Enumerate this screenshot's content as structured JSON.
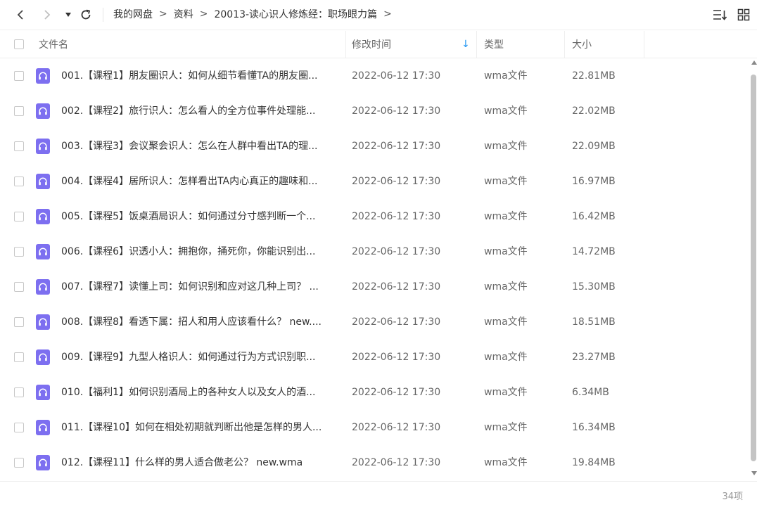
{
  "nav": {
    "back_icon": "chevron-left-icon",
    "forward_icon": "chevron-right-icon",
    "history_icon": "caret-down-icon",
    "refresh_icon": "refresh-icon"
  },
  "breadcrumb": [
    "我的网盘",
    "资料",
    "20013-读心识人修炼经：职场眼力篇"
  ],
  "breadcrumb_separator": ">",
  "toolbar": {
    "sort_icon": "sort-list-icon",
    "grid_icon": "grid-view-icon"
  },
  "columns": {
    "name": "文件名",
    "modified": "修改时间",
    "type": "类型",
    "size": "大小",
    "sort_indicator": "↓"
  },
  "colors": {
    "accent": "#2196f3",
    "file_icon": "#7d6ff0"
  },
  "files": [
    {
      "name": "001.【课程1】朋友圈识人：如何从细节看懂TA的朋友圈...",
      "modified": "2022-06-12 17:30",
      "type": "wma文件",
      "size": "22.81MB"
    },
    {
      "name": "002.【课程2】旅行识人：怎么看人的全方位事件处理能...",
      "modified": "2022-06-12 17:30",
      "type": "wma文件",
      "size": "22.02MB"
    },
    {
      "name": "003.【课程3】会议聚会识人：怎么在人群中看出TA的理...",
      "modified": "2022-06-12 17:30",
      "type": "wma文件",
      "size": "22.09MB"
    },
    {
      "name": "004.【课程4】居所识人：怎样看出TA内心真正的趣味和...",
      "modified": "2022-06-12 17:30",
      "type": "wma文件",
      "size": "16.97MB"
    },
    {
      "name": "005.【课程5】饭桌酒局识人：如何通过分寸感判断一个...",
      "modified": "2022-06-12 17:30",
      "type": "wma文件",
      "size": "16.42MB"
    },
    {
      "name": "006.【课程6】识透小人：拥抱你，捅死你，你能识别出...",
      "modified": "2022-06-12 17:30",
      "type": "wma文件",
      "size": "14.72MB"
    },
    {
      "name": "007.【课程7】读懂上司：如何识别和应对这几种上司？ ...",
      "modified": "2022-06-12 17:30",
      "type": "wma文件",
      "size": "15.30MB"
    },
    {
      "name": "008.【课程8】看透下属：招人和用人应该看什么？ new....",
      "modified": "2022-06-12 17:30",
      "type": "wma文件",
      "size": "18.51MB"
    },
    {
      "name": "009.【课程9】九型人格识人：如何通过行为方式识别职...",
      "modified": "2022-06-12 17:30",
      "type": "wma文件",
      "size": "23.27MB"
    },
    {
      "name": "010.【福利1】如何识别酒局上的各种女人以及女人的酒...",
      "modified": "2022-06-12 17:30",
      "type": "wma文件",
      "size": "6.34MB"
    },
    {
      "name": "011.【课程10】如何在相处初期就判断出他是怎样的男人...",
      "modified": "2022-06-12 17:30",
      "type": "wma文件",
      "size": "16.34MB"
    },
    {
      "name": "012.【课程11】什么样的男人适合做老公？ new.wma",
      "modified": "2022-06-12 17:30",
      "type": "wma文件",
      "size": "19.84MB"
    }
  ],
  "file_icon": "headphones-icon",
  "footer": {
    "count": "34项"
  }
}
